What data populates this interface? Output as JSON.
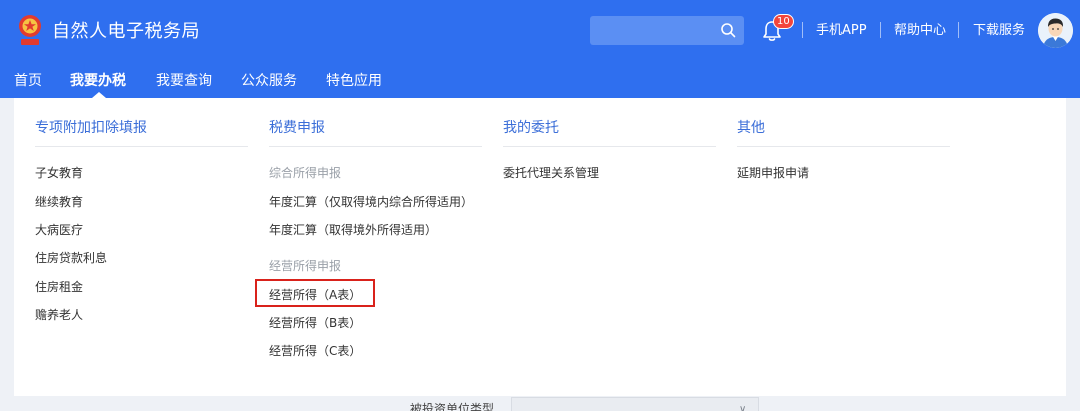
{
  "header": {
    "title": "自然人电子税务局",
    "logo_icon": "tax-emblem-icon",
    "search_placeholder": "",
    "notification_count": "10",
    "links": [
      "手机APP",
      "帮助中心",
      "下载服务"
    ],
    "brand_color": "#2f6fef"
  },
  "nav": {
    "items": [
      "首页",
      "我要办税",
      "我要查询",
      "公众服务",
      "特色应用"
    ],
    "active": "我要办税"
  },
  "menu": {
    "columns": [
      {
        "header": "专项附加扣除填报",
        "items": [
          {
            "label": "子女教育"
          },
          {
            "label": "继续教育"
          },
          {
            "label": "大病医疗"
          },
          {
            "label": "住房贷款利息"
          },
          {
            "label": "住房租金"
          },
          {
            "label": "赡养老人"
          }
        ]
      },
      {
        "header": "税费申报",
        "items": [
          {
            "label": "综合所得申报"
          },
          {
            "label": "年度汇算（仅取得境内综合所得适用）"
          },
          {
            "label": "年度汇算（取得境外所得适用）"
          },
          {
            "label": "经营所得申报"
          },
          {
            "label": "经营所得（A表）"
          },
          {
            "label": "经营所得（B表）"
          },
          {
            "label": "经营所得（C表）"
          }
        ]
      },
      {
        "header": "我的委托",
        "items": [
          {
            "label": "委托代理关系管理"
          }
        ]
      },
      {
        "header": "其他",
        "items": [
          {
            "label": "延期申报申请"
          }
        ]
      }
    ],
    "highlight_color": "#d9221b"
  },
  "below": {
    "label": "被投资单位类型"
  }
}
